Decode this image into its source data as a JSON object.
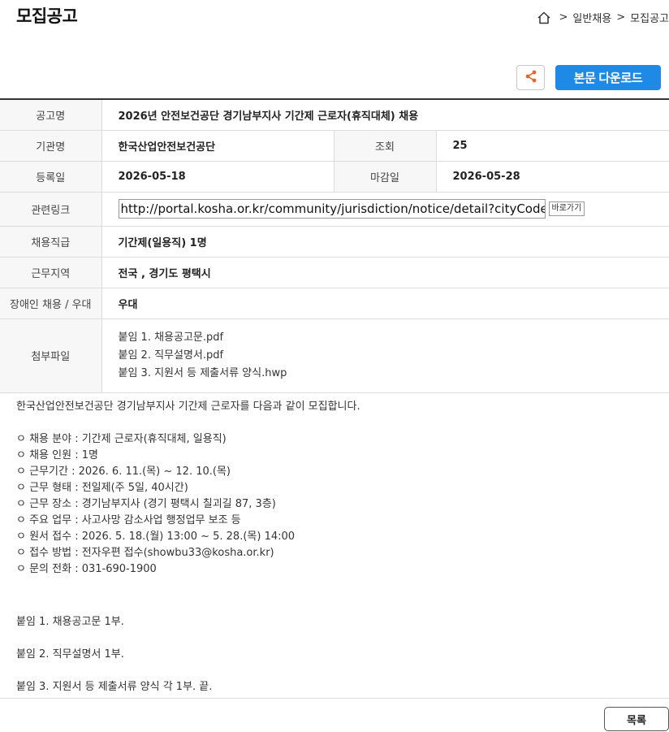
{
  "header": {
    "title": "모집공고",
    "breadcrumb": [
      "일반채용",
      "모집공고"
    ]
  },
  "actions": {
    "download_label": "본문 다운로드",
    "list_label": "목록"
  },
  "info": {
    "notice_label": "공고명",
    "notice_value": "2026년 안전보건공단 경기남부지사 기간제 근로자(휴직대체) 채용",
    "org_label": "기관명",
    "org_value": "한국산업안전보건공단",
    "views_label": "조회",
    "views_value": "25",
    "reg_label": "등록일",
    "reg_value": "2026-05-18",
    "deadline_label": "마감일",
    "deadline_value": "2026-05-28",
    "link_label": "관련링크",
    "link_value": "http://portal.kosha.or.kr/community/jurisdiction/notice/detail?cityCode",
    "link_go": "바로가기",
    "job_label": "채용직급",
    "job_value": "기간제(일용직) 1명",
    "region_label": "근무지역",
    "region_value": "전국 , 경기도 평택시",
    "disabled_label": "장애인 채용 / 우대",
    "disabled_value": "우대",
    "files_label": "첨부파일",
    "files": [
      "붙임 1. 채용공고문.pdf",
      "붙임 2. 직무설명서.pdf",
      "붙임 3. 지원서 등 제출서류 양식.hwp"
    ]
  },
  "content": {
    "intro": "한국산업안전보건공단 경기남부지사 기간제 근로자를 다음과 같이 모집합니다.",
    "items": [
      "ㅇ 채용 분야 : 기간제 근로자(휴직대체, 일용직)",
      "ㅇ 채용 인원 : 1명",
      "ㅇ 근무기간 : 2026. 6. 11.(목) ~ 12. 10.(목)",
      "ㅇ 근무 형태 : 전일제(주 5일, 40시간)",
      "ㅇ 근무 장소 : 경기남부지사 (경기 평택시 칠괴길 87, 3층)",
      "ㅇ 주요 업무 : 사고사망 감소사업 행정업무 보조 등",
      "ㅇ 원서 접수 : 2026. 5. 18.(월) 13:00 ~ 5. 28.(목) 14:00",
      "ㅇ 접수 방법 : 전자우편 접수(showbu33@kosha.or.kr)",
      "ㅇ 문의 전화 : 031-690-1900"
    ],
    "attach1": "붙임 1. 채용공고문 1부.",
    "attach2": "붙임 2. 직무설명서 1부.",
    "attach3": "붙임 3. 지원서 등 제출서류 양식 각 1부.  끝."
  },
  "icons": {
    "home": "home-icon",
    "share": "share-icon"
  },
  "colors": {
    "accent": "#1e8ae6",
    "share_icon": "#e8642c"
  }
}
